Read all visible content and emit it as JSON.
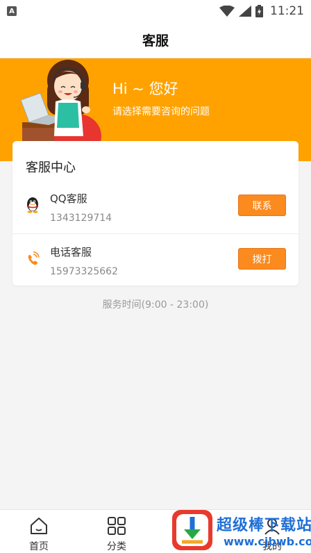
{
  "status_bar": {
    "time": "11:21",
    "app_icon": "A"
  },
  "header": {
    "title": "客服"
  },
  "banner": {
    "greeting": "Hi ~ 您好",
    "subtitle": "请选择需要咨询的问题",
    "background": "#ffa200"
  },
  "service_center": {
    "title": "客服中心",
    "rows": [
      {
        "name": "QQ客服",
        "number": "1343129714",
        "button": "联系",
        "icon": "qq-penguin-icon"
      },
      {
        "name": "电话客服",
        "number": "15973325662",
        "button": "拨打",
        "icon": "phone-icon"
      }
    ],
    "accent": "#fb8a1f"
  },
  "service_hours": "服务时间(9:00 - 23:00)",
  "bottom_nav": [
    {
      "label": "首页",
      "icon": "home-icon"
    },
    {
      "label": "分类",
      "icon": "category-grid-icon"
    },
    {
      "label": "",
      "icon": ""
    },
    {
      "label": "我的",
      "icon": "profile-icon"
    }
  ],
  "watermark": {
    "text": "超级棒下载站",
    "url": "www.cjbwb.com"
  }
}
